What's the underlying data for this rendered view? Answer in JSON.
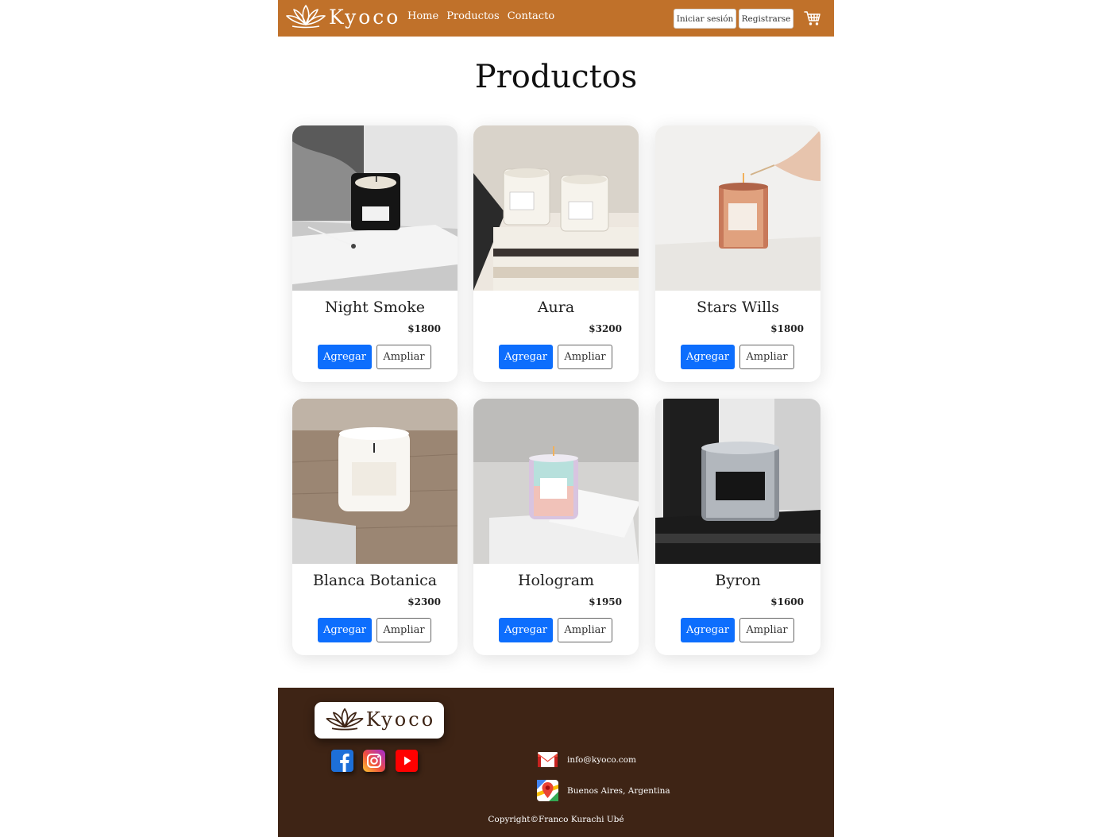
{
  "brand": {
    "name": "Kyoco"
  },
  "nav": {
    "links": [
      "Home",
      "Productos",
      "Contacto"
    ],
    "signin_label": "Iniciar sesión",
    "register_label": "Registrarse"
  },
  "main": {
    "title": "Productos"
  },
  "products": [
    {
      "name": "Night Smoke",
      "price": "$1800",
      "add_label": "Agregar",
      "zoom_label": "Ampliar"
    },
    {
      "name": "Aura",
      "price": "$3200",
      "add_label": "Agregar",
      "zoom_label": "Ampliar"
    },
    {
      "name": "Stars Wills",
      "price": "$1800",
      "add_label": "Agregar",
      "zoom_label": "Ampliar"
    },
    {
      "name": "Blanca Botanica",
      "price": "$2300",
      "add_label": "Agregar",
      "zoom_label": "Ampliar"
    },
    {
      "name": "Hologram",
      "price": "$1950",
      "add_label": "Agregar",
      "zoom_label": "Ampliar"
    },
    {
      "name": "Byron",
      "price": "$1600",
      "add_label": "Agregar",
      "zoom_label": "Ampliar"
    }
  ],
  "footer": {
    "brand": "Kyoco",
    "social": [
      "facebook-icon",
      "instagram-icon",
      "youtube-icon"
    ],
    "email": "info@kyoco.com",
    "location": "Buenos Aires, Argentina",
    "copyright": "Copyright©Franco Kurachi Ubé"
  },
  "colors": {
    "navbar": "#c0712a",
    "footer": "#3e2415",
    "primary_button": "#0d6efd"
  }
}
